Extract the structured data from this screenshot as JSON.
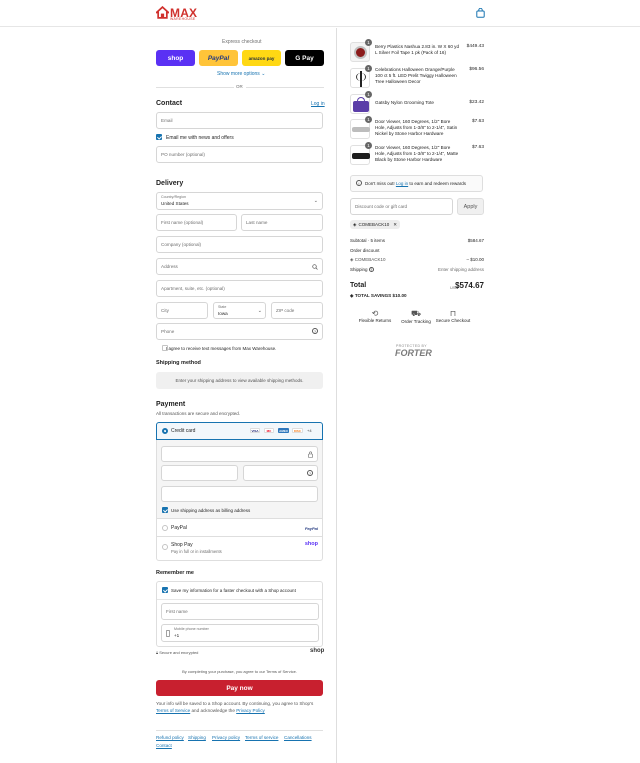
{
  "header": {
    "brand": "MAX",
    "brand_sub": "WAREHOUSE"
  },
  "express": {
    "title": "Express checkout",
    "buttons": [
      {
        "label": "shop",
        "color": "#5a31f4"
      },
      {
        "label": "PayPal",
        "color": "#ffc439"
      },
      {
        "label": "amazon pay",
        "color": "#ffd814"
      },
      {
        "label": "G Pay",
        "color": "#000000"
      }
    ],
    "more": "Show more options",
    "or": "OR"
  },
  "contact": {
    "title": "Contact",
    "login": "Log in",
    "email_placeholder": "Email",
    "news_label": "Email me with news and offers",
    "po_placeholder": "PO number (optional)"
  },
  "delivery": {
    "title": "Delivery",
    "country_label": "Country/Region",
    "country_value": "United States",
    "first_name": "First name (optional)",
    "last_name": "Last name",
    "company": "Company (optional)",
    "address": "Address",
    "apartment": "Apartment, suite, etc. (optional)",
    "city": "City",
    "state_label": "State",
    "state_value": "Iowa",
    "zip": "ZIP code",
    "phone": "Phone",
    "sms_label": "I agree to receive text messages from Max Warehouse."
  },
  "shipping": {
    "title": "Shipping method",
    "note": "Enter your shipping address to view available shipping methods."
  },
  "payment": {
    "title": "Payment",
    "subtitle": "All transactions are secure and encrypted.",
    "credit_card": "Credit card",
    "card_badges": [
      "VISA",
      "MC",
      "AMEX",
      "DISC",
      "+4"
    ],
    "billing_label": "Use shipping address as billing address",
    "paypal": "PayPal",
    "shop_pay": "Shop Pay",
    "shop_pay_sub": "Pay in full or in installments"
  },
  "remember": {
    "title": "Remember me",
    "save_label": "Save my information for a faster checkout with a Shop account",
    "first_name": "First name",
    "phone_label": "Mobile phone number",
    "phone_value": "+1",
    "secure": "Secure and encrypted",
    "shop_logo": "shop"
  },
  "terms_line": "By completing your purchase, you agree to our Terms of Service.",
  "pay_now": "Pay now",
  "saved_note_1": "Your info will be saved to a Shop account. By continuing, you agree to Shop's",
  "saved_note_terms": "Terms of Service",
  "saved_note_mid": "and acknowledge the",
  "saved_note_privacy": "Privacy Policy",
  "footer": [
    "Refund policy",
    "Shipping",
    "Privacy policy",
    "Terms of service",
    "Cancellations",
    "Contact"
  ],
  "cart": {
    "items": [
      {
        "name": "Berry Plastics Nashua 2.83 in. W X 60 yd L Silver Foil Tape 1 pk (Pack of 16)",
        "price": "$449.43",
        "qty": "1",
        "color": "#8b1a1a"
      },
      {
        "name": "Celebrations Halloween Orange/Purple 100 ct 5 ft. LED Prelit Twiggy Halloween Tree Halloween Decor",
        "price": "$96.56",
        "qty": "1",
        "color": "#222222"
      },
      {
        "name": "Gatsby Nylon Grooming Tote",
        "price": "$23.42",
        "qty": "1",
        "color": "#5b3ea8"
      },
      {
        "name": "Door Viewer, 160 Degrees, 1/2\" Bore Hole, Adjusts from 1-3/8\" to 2-1/4\", Satin Nickel by Stone Harbor Hardware",
        "price": "$7.63",
        "qty": "1",
        "color": "#bdbdbd"
      },
      {
        "name": "Door Viewer, 160 Degrees, 1/2\" Bore Hole, Adjusts from 1-3/8\" to 2-1/4\", Matte Black by Stone Harbor Hardware",
        "price": "$7.63",
        "qty": "1",
        "color": "#1e1e1e"
      }
    ],
    "rewards_pre": "Don't miss out!",
    "rewards_link": "Log in",
    "rewards_post": "to earn and redeem rewards",
    "discount_placeholder": "Discount code or gift card",
    "apply": "Apply",
    "code_tag": "COMEBACK10",
    "subtotal_label": "Subtotal · 5 items",
    "subtotal_value": "$584.67",
    "order_discount_label": "Order discount",
    "discount_code": "COMEBACK10",
    "discount_value": "– $10.00",
    "shipping_label": "Shipping",
    "shipping_value": "Enter shipping address",
    "total_label": "Total",
    "currency": "USD",
    "total_value": "$574.67",
    "savings_label": "TOTAL SAVINGS",
    "savings_value": "$10.00",
    "badges": [
      "Flexible Returns",
      "Order Tracking",
      "Secure Checkout"
    ],
    "protected_by": "PROTECTED BY",
    "forter": "FORTER"
  }
}
